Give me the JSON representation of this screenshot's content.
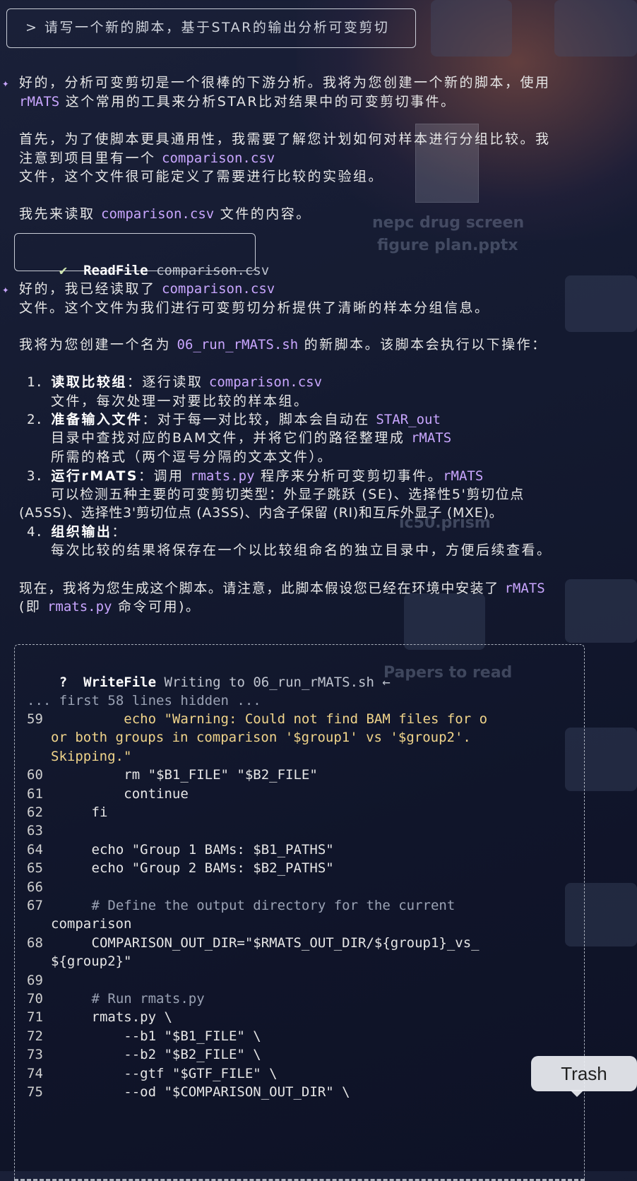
{
  "prompt": {
    "marker": ">",
    "text": "请写一个新的脚本，基于STAR的输出分析可变剪切"
  },
  "desktop": {
    "items": [
      "nepc drug screen",
      "figure plan.pptx",
      "ic50.prism",
      "Papers to read"
    ],
    "trash_label": "Trash"
  },
  "msg1": {
    "sparkle": "✦",
    "p1a": "好的，分析可变剪切是一个很棒的下游分析。我将为您创建一个新的脚本，使用",
    "p1b_tool": "rMATS",
    "p1b_rest": " 这个常用的工具来分析STAR比对结果中的可变剪切事件。",
    "p2a": "首先，为了使脚本更具通用性，我需要了解您计划如何对样本进行分组比较。我",
    "p2b": "注意到项目里有一个 ",
    "p2b_file": "comparison.csv",
    "p2c": "文件，这个文件很可能定义了需要进行比较的实验组。",
    "p3a": "我先来读取 ",
    "p3_file": "comparison.csv",
    "p3b": " 文件的内容。"
  },
  "readfile": {
    "icon": "✔",
    "tool": "ReadFile",
    "arg": "comparison.csv"
  },
  "msg2": {
    "sparkle": "✦",
    "p1a": "好的，我已经读取了 ",
    "p1_file": "comparison.csv",
    "p1b": "文件。这个文件为我们进行可变剪切分析提供了清晰的样本分组信息。",
    "p2a": "我将为您创建一个名为 ",
    "p2_file": "06_run_rMATS.sh",
    "p2b": " 的新脚本。该脚本会执行以下操作：",
    "i1_num": "1.",
    "i1_title": "读取比较组",
    "i1_a": "：逐行读取 ",
    "i1_file": "comparison.csv",
    "i1_b": "文件，每次处理一对要比较的样本组。",
    "i2_num": "2.",
    "i2_title": "准备输入文件",
    "i2_a": "：对于每一对比较，脚本会自动在 ",
    "i2_dir": "STAR_out",
    "i2_b": "目录中查找对应的BAM文件，并将它们的路径整理成 ",
    "i2_tool": "rMATS",
    "i2_c": "所需的格式（两个逗号分隔的文本文件）。",
    "i3_num": "3.",
    "i3_title": "运行rMATS",
    "i3_a": "：调用 ",
    "i3_cmd": "rmats.py",
    "i3_a2": " 程序来分析可变剪切事件。",
    "i3_tool": "rMATS",
    "i3_b": "可以检测五种主要的可变剪切类型：外显子跳跃 (SE)、选择性5'剪切位点",
    "i3_c": "(A5SS)、选择性3'剪切位点 (A3SS)、内含子保留 (RI)和互斥外显子 (MXE)。",
    "i4_num": "4.",
    "i4_title": "组织输出",
    "i4_a": "：",
    "i4_b": "每次比较的结果将保存在一个以比较组命名的独立目录中，方便后续查看。",
    "p3a": "现在，我将为您生成这个脚本。请注意，此脚本假设您已经在环境中安装了 ",
    "p3_tool": "rMATS",
    "p3b_open": "(即 ",
    "p3_cmd": "rmats.py",
    "p3b_close": " 命令可用)。"
  },
  "writefile": {
    "icon": "?",
    "tool": "WriteFile",
    "desc": "Writing to 06_run_rMATS.sh ←",
    "hidden": "... first 58 lines hidden ...",
    "lines": [
      {
        "n": "59",
        "t": "        echo \"Warning: Could not find BAM files for o"
      },
      {
        "n": "",
        "t": "or both groups in comparison '$group1' vs '$group2'."
      },
      {
        "n": "",
        "t": "Skipping.\""
      },
      {
        "n": "60",
        "t": "        rm \"$B1_FILE\" \"$B2_FILE\""
      },
      {
        "n": "61",
        "t": "        continue"
      },
      {
        "n": "62",
        "t": "    fi"
      },
      {
        "n": "63",
        "t": ""
      },
      {
        "n": "64",
        "t": "    echo \"Group 1 BAMs: $B1_PATHS\""
      },
      {
        "n": "65",
        "t": "    echo \"Group 2 BAMs: $B2_PATHS\""
      },
      {
        "n": "66",
        "t": ""
      },
      {
        "n": "67",
        "t": "    # Define the output directory for the current"
      },
      {
        "n": "",
        "t": "comparison"
      },
      {
        "n": "68",
        "t": "    COMPARISON_OUT_DIR=\"$RMATS_OUT_DIR/${group1}_vs_"
      },
      {
        "n": "",
        "t": "${group2}\""
      },
      {
        "n": "69",
        "t": ""
      },
      {
        "n": "70",
        "t": "    # Run rmats.py"
      },
      {
        "n": "71",
        "t": "    rmats.py \\"
      },
      {
        "n": "72",
        "t": "        --b1 \"$B1_FILE\" \\"
      },
      {
        "n": "73",
        "t": "        --b2 \"$B2_FILE\" \\"
      },
      {
        "n": "74",
        "t": "        --gtf \"$GTF_FILE\" \\"
      },
      {
        "n": "75",
        "t": "        --od \"$COMPARISON_OUT_DIR\" \\"
      }
    ]
  }
}
